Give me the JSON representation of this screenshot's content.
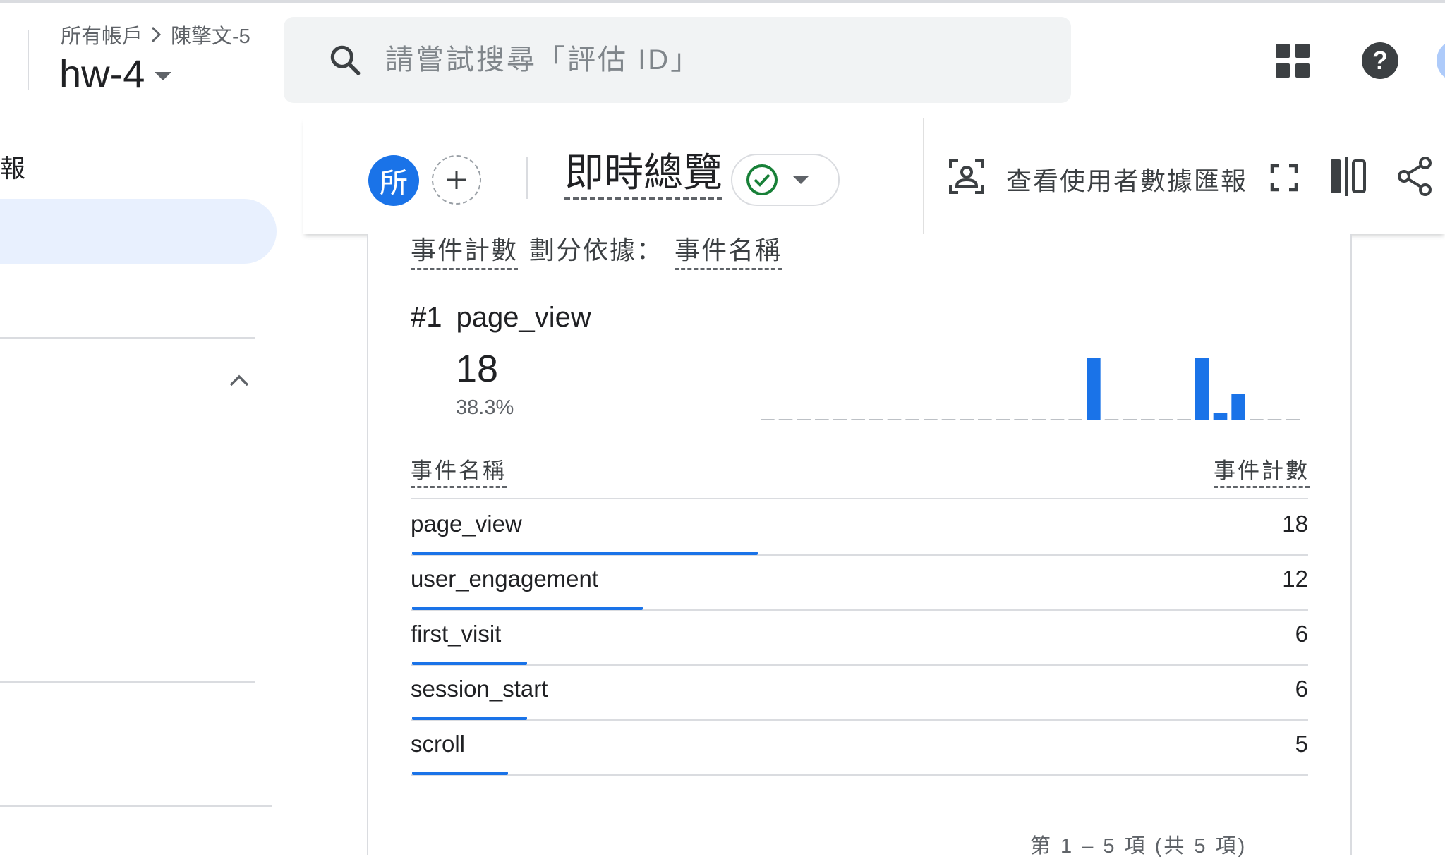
{
  "header": {
    "breadcrumb_all": "所有帳戶",
    "breadcrumb_account": "陳擎文-5",
    "property": "hw-4",
    "search_placeholder": "請嘗試搜尋「評估 ID」",
    "icons": [
      "search-icon",
      "apps-grid-icon",
      "help-icon"
    ]
  },
  "left_nav": {
    "title": "報"
  },
  "toolbar": {
    "comparison_chip": "所",
    "report_title": "即時總覽",
    "user_data_link": "查看使用者數據匯報",
    "status_color": "#188038"
  },
  "card": {
    "metric": "事件計數",
    "by": "劃分依據：",
    "dimension": "事件名稱",
    "top_rank": "#1",
    "top_name": "page_view",
    "top_value": "18",
    "top_percent": "38.3%",
    "sparkline_values": [
      0,
      0,
      0,
      0,
      0,
      0,
      0,
      0,
      0,
      0,
      0,
      0,
      0,
      0,
      0,
      0,
      0,
      0,
      4,
      0,
      0,
      0,
      0,
      0,
      4,
      0.5,
      1.7,
      0,
      0,
      0
    ],
    "col_name": "事件名稱",
    "col_count": "事件計數",
    "rows": [
      {
        "name": "page_view",
        "count": "18",
        "value": 18
      },
      {
        "name": "user_engagement",
        "count": "12",
        "value": 12
      },
      {
        "name": "first_visit",
        "count": "6",
        "value": 6
      },
      {
        "name": "session_start",
        "count": "6",
        "value": 6
      },
      {
        "name": "scroll",
        "count": "5",
        "value": 5
      }
    ],
    "pagination": "第 1 – 5 項 (共 5 項)",
    "bar_color": "#1a73e8"
  }
}
